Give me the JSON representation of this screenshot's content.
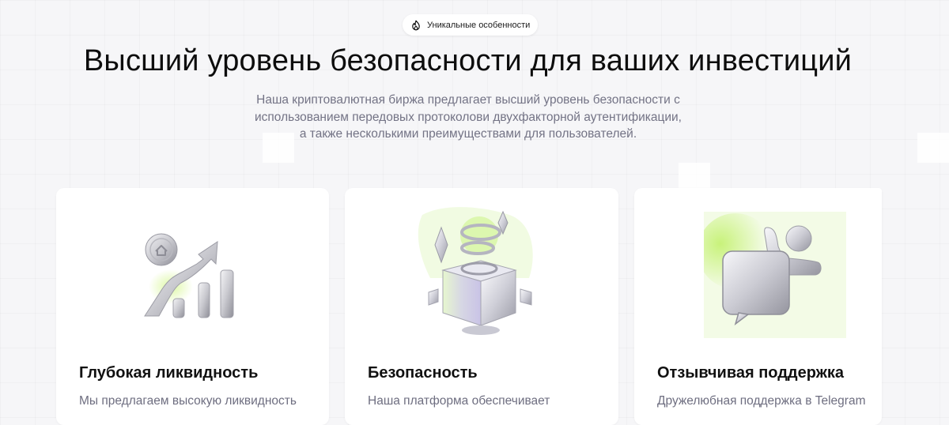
{
  "badge": {
    "icon": "fire-icon",
    "label": "Уникальные особенности"
  },
  "hero": {
    "title": "Высший уровень безопасности для ваших инвестиций",
    "subtitle": "Наша криптовалютная биржа предлагает высший уровень безопасности с использованием передовых протоколови двухфакторной аутентификации, а также несколькими преимуществами для пользователей."
  },
  "features": [
    {
      "icon": "growth-chart-icon",
      "title": "Глубокая ликвидность",
      "text": "Мы предлагаем высокую ликвидность"
    },
    {
      "icon": "secure-box-icon",
      "title": "Безопасность",
      "text": "Наша платформа обеспечивает"
    },
    {
      "icon": "support-chat-icon",
      "title": "Отзывчивая поддержка",
      "text": "Дружелюбная поддержка в Telegram"
    }
  ],
  "colors": {
    "accent_green": "#c8f27a",
    "text_muted": "#737385",
    "background": "#f6f6f8"
  }
}
